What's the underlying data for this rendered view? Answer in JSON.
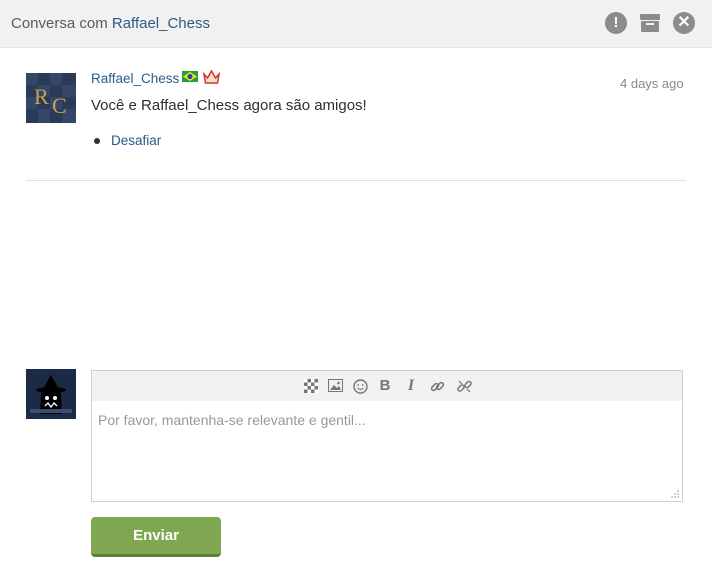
{
  "header": {
    "title_prefix": "Conversa com",
    "username": "Raffael_Chess",
    "icons": [
      "alert-icon",
      "archive-icon",
      "close-icon"
    ]
  },
  "message": {
    "avatar_text": "RC",
    "username": "Raffael_Chess",
    "flag": "brazil-flag-icon",
    "badge": "crown-icon",
    "time": "4 days ago",
    "text": "Você e Raffael_Chess agora são amigos!",
    "actions": [
      "Desafiar"
    ]
  },
  "composer": {
    "toolbar": [
      "board-icon",
      "image-icon",
      "emoji-icon",
      "B",
      "I",
      "link-icon",
      "unlink-icon"
    ],
    "placeholder": "Por favor, mantenha-se relevante e gentil...",
    "send_label": "Enviar"
  },
  "colors": {
    "link": "#2c5b85",
    "send_button": "#7fa650",
    "header_bg": "#f1f1f1"
  }
}
